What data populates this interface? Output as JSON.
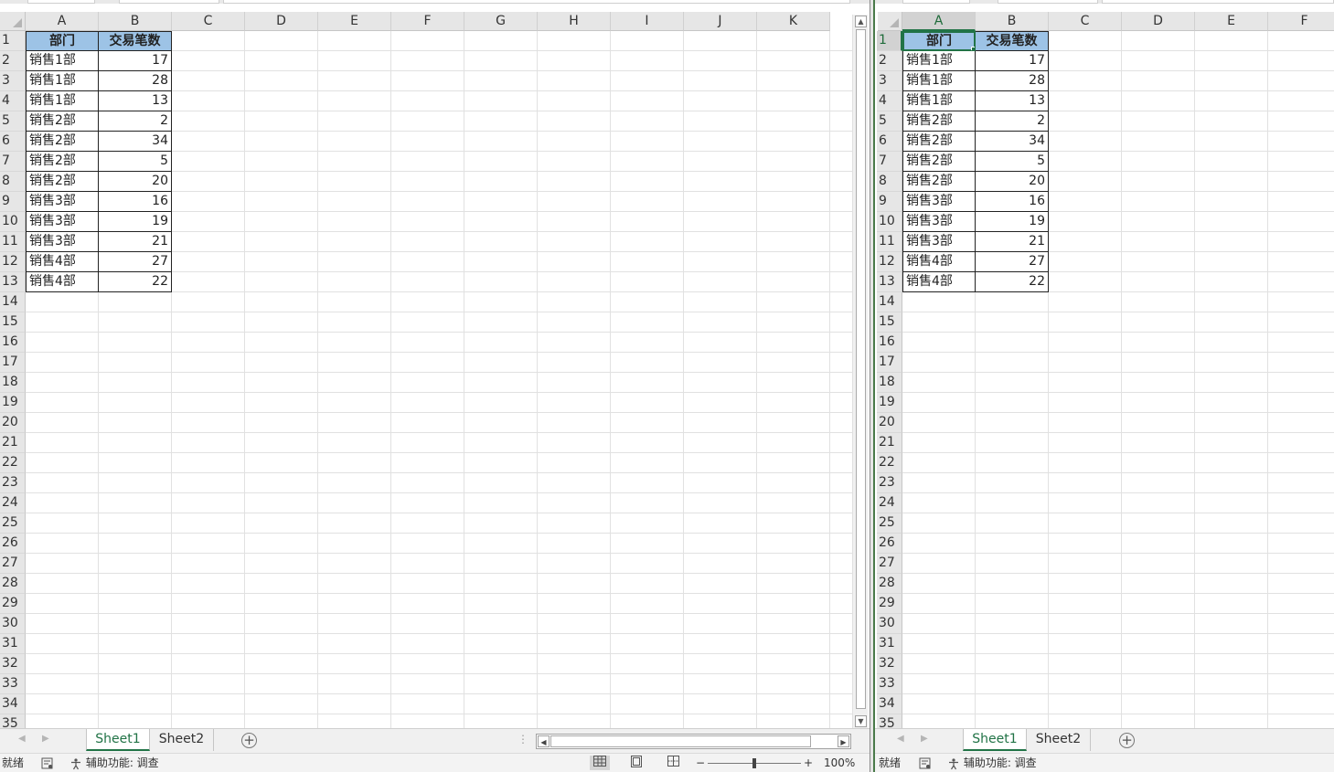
{
  "columns_left": [
    "A",
    "B",
    "C",
    "D",
    "E",
    "F",
    "G",
    "H",
    "I",
    "J",
    "K"
  ],
  "columns_right": [
    "A",
    "B",
    "C",
    "D",
    "E",
    "F"
  ],
  "rows": [
    "1",
    "2",
    "3",
    "4",
    "5",
    "6",
    "7",
    "8",
    "9",
    "10",
    "11",
    "12",
    "13",
    "14",
    "15",
    "16",
    "17",
    "18",
    "19",
    "20",
    "21",
    "22",
    "23",
    "24",
    "25",
    "26",
    "27",
    "28",
    "29",
    "30",
    "31",
    "32",
    "33",
    "34",
    "35"
  ],
  "table": {
    "headers": [
      "部门",
      "交易笔数"
    ],
    "rows": [
      [
        "销售1部",
        "17"
      ],
      [
        "销售1部",
        "28"
      ],
      [
        "销售1部",
        "13"
      ],
      [
        "销售2部",
        "2"
      ],
      [
        "销售2部",
        "34"
      ],
      [
        "销售2部",
        "5"
      ],
      [
        "销售2部",
        "20"
      ],
      [
        "销售3部",
        "16"
      ],
      [
        "销售3部",
        "19"
      ],
      [
        "销售3部",
        "21"
      ],
      [
        "销售4部",
        "27"
      ],
      [
        "销售4部",
        "22"
      ]
    ]
  },
  "sheets": [
    "Sheet1",
    "Sheet2"
  ],
  "active_sheet": "Sheet1",
  "status": {
    "ready": "就绪",
    "accessibility": "辅助功能: 调查",
    "zoom": "100%",
    "zoom_minus": "−",
    "zoom_plus": "+"
  },
  "icons": {
    "add_sheet": "plus-circle-icon",
    "scroll_left": "chevron-left-icon",
    "scroll_right": "chevron-right-icon"
  },
  "colors": {
    "header_fill": "#9dc3e6",
    "accent": "#217346",
    "grid": "#e1e1e1"
  }
}
